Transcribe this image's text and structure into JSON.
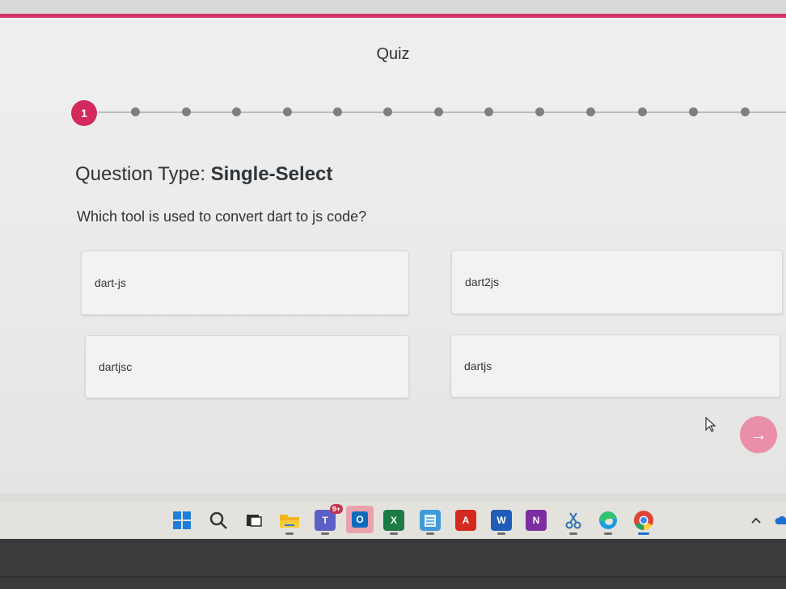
{
  "quiz": {
    "title": "Quiz",
    "current_step": "1",
    "total_steps": 14
  },
  "question": {
    "type_label": "Question Type:",
    "type_value": "Single-Select",
    "text": "Which tool is used to convert dart to js code?"
  },
  "options": [
    "dart-js",
    "dart2js",
    "dartjsc",
    "dartjs"
  ],
  "next_button": {
    "icon": "arrow-right-icon"
  },
  "taskbar": {
    "teams_badge": "9+",
    "icons": [
      "windows-start-icon",
      "search-icon",
      "task-view-icon",
      "file-explorer-icon",
      "teams-icon",
      "outlook-icon",
      "excel-icon",
      "notepad-icon",
      "acrobat-icon",
      "word-icon",
      "onenote-icon",
      "snipping-tool-icon",
      "edge-icon",
      "chrome-icon",
      "chevron-up-icon"
    ]
  },
  "colors": {
    "accent": "#d2336a",
    "step_current": "#d22a5d",
    "next_button": "#ea8fa8"
  }
}
